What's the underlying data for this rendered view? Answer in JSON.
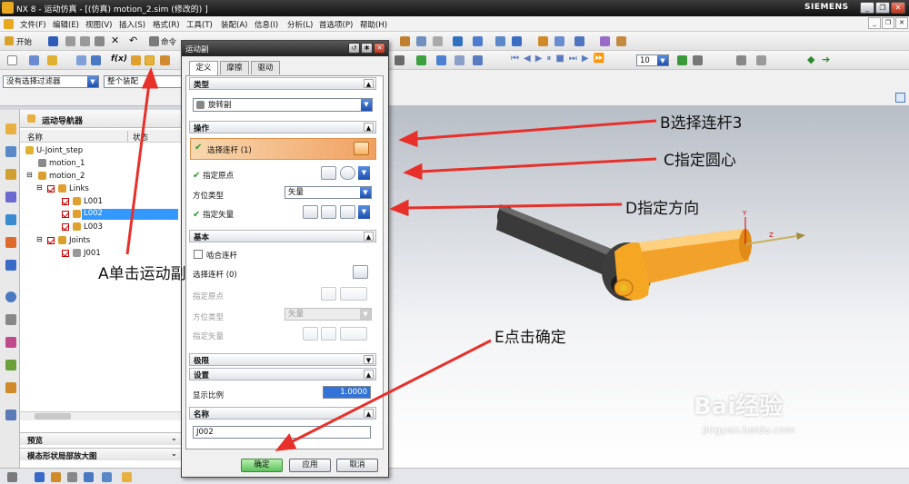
{
  "window": {
    "title": "NX 8 - 运动仿真 - [(仿真) motion_2.sim  (修改的) ]",
    "brand": "SIEMENS"
  },
  "menu": [
    "文件(F)",
    "编辑(E)",
    "视图(V)",
    "插入(S)",
    "格式(R)",
    "工具(T)",
    "装配(A)",
    "信息(I)",
    "分析(L)",
    "首选项(P)",
    "帮助(H)"
  ],
  "toolbar": {
    "start_label": "开始",
    "command_label": "命令",
    "zoom_value": "10"
  },
  "filter": {
    "select_filter": "没有选择过滤器",
    "scope": "整个装配"
  },
  "navigator": {
    "title": "运动导航器",
    "columns": [
      "名称",
      "状态"
    ],
    "tree": [
      {
        "label": "U-Joint_step",
        "indent": 0
      },
      {
        "label": "motion_1",
        "indent": 1
      },
      {
        "label": "motion_2",
        "indent": 1
      },
      {
        "label": "Links",
        "indent": 2
      },
      {
        "label": "L001",
        "indent": 3
      },
      {
        "label": "L002",
        "indent": 3,
        "selected": true
      },
      {
        "label": "L003",
        "indent": 3
      },
      {
        "label": "Joints",
        "indent": 2
      },
      {
        "label": "J001",
        "indent": 3
      }
    ],
    "bottom_sections": [
      "预览",
      "模态形状局部放大图"
    ]
  },
  "dialog": {
    "title": "运动副",
    "tabs": [
      "定义",
      "摩擦",
      "驱动"
    ],
    "groups": {
      "type": "类型",
      "operation": "操作",
      "base": "基本",
      "limit": "极限",
      "settings": "设置",
      "name": "名称"
    },
    "type_value": "旋转副",
    "op": {
      "select_link": "选择连杆 (1)",
      "origin": "指定原点",
      "orient_label": "方位类型",
      "orient_value": "矢量",
      "vector": "指定矢量"
    },
    "base": {
      "snap": "啮合连杆",
      "select_link": "选择连杆 (0)",
      "origin": "指定原点",
      "orient_label": "方位类型",
      "orient_value": "矢量",
      "vector": "指定矢量"
    },
    "settings": {
      "scale_label": "显示比例",
      "scale_value": "1.0000"
    },
    "name_value": "J002",
    "buttons": {
      "ok": "确定",
      "apply": "应用",
      "cancel": "取消"
    }
  },
  "annotations": {
    "A": "A单击运动副",
    "B": "B选择连杆3",
    "C": "C指定圆心",
    "D": "D指定方向",
    "E": "E点击确定"
  },
  "watermark": {
    "brand": "Bai经验",
    "url": "jingyan.baidu.com"
  },
  "colors": {
    "arrow": "#e8302a",
    "part_orange": "#f5a623",
    "selection_blue": "#3399ff",
    "ok_green": "#5cc25c"
  }
}
